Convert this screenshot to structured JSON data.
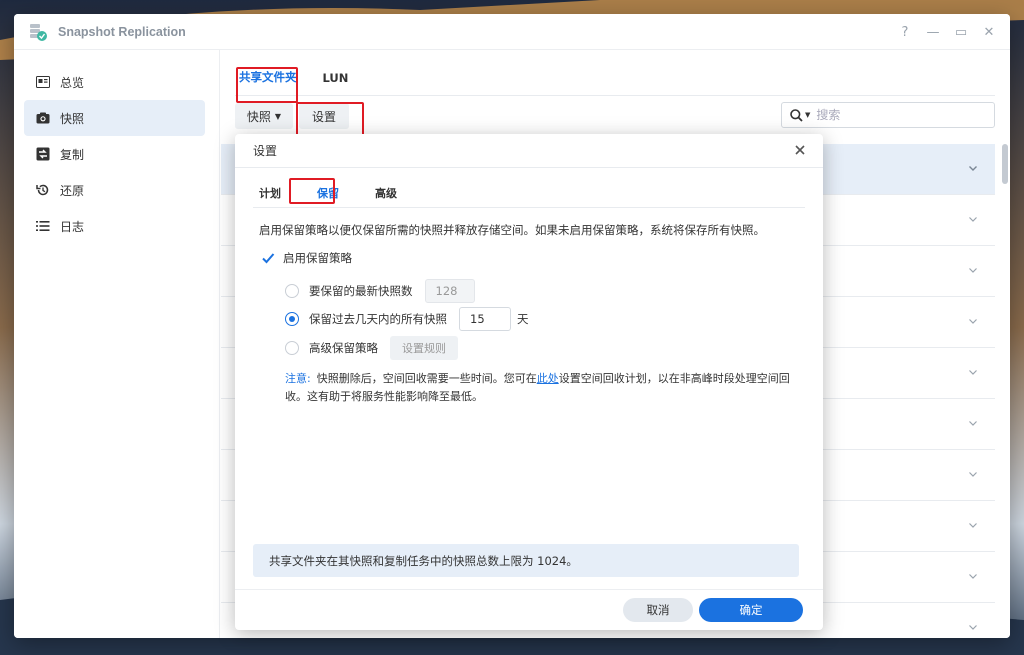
{
  "window": {
    "title": "Snapshot Replication",
    "controls": [
      "?",
      "—",
      "▭",
      "✕"
    ]
  },
  "sidebar": {
    "items": [
      {
        "label": "总览",
        "icon": "overview-icon"
      },
      {
        "label": "快照",
        "icon": "camera-icon"
      },
      {
        "label": "复制",
        "icon": "replication-icon"
      },
      {
        "label": "还原",
        "icon": "restore-icon"
      },
      {
        "label": "日志",
        "icon": "list-icon"
      }
    ],
    "active_index": 1
  },
  "main": {
    "tabs": [
      {
        "label": "共享文件夹"
      },
      {
        "label": "LUN"
      }
    ],
    "toolbar": {
      "snapshot_label": "快照",
      "settings_label": "设置"
    },
    "search": {
      "placeholder": "搜索"
    }
  },
  "dialog": {
    "title": "设置",
    "tabs": [
      {
        "label": "计划"
      },
      {
        "label": "保留"
      },
      {
        "label": "高级"
      }
    ],
    "description": "启用保留策略以便仅保留所需的快照并释放存储空间。如果未启用保留策略，系统将保存所有快照。",
    "enable_label": "启用保留策略",
    "options": {
      "latest": {
        "label": "要保留的最新快照数",
        "value": "128"
      },
      "days": {
        "label": "保留过去几天内的所有快照",
        "value": "15",
        "unit": "天"
      },
      "advanced": {
        "label": "高级保留策略",
        "button": "设置规则"
      }
    },
    "note": {
      "label": "注意:",
      "text_before": "快照删除后，空间回收需要一些时间。您可在",
      "link": "此处",
      "text_after": "设置空间回收计划，以在非高峰时段处理空间回收。这有助于将服务性能影响降至最低。"
    },
    "info": "共享文件夹在其快照和复制任务中的快照总数上限为 1024。",
    "cancel_label": "取消",
    "ok_label": "确定"
  },
  "colors": {
    "accent": "#1b72e0",
    "highlight": "#e01b24",
    "selected_bg": "#e6eef8"
  }
}
